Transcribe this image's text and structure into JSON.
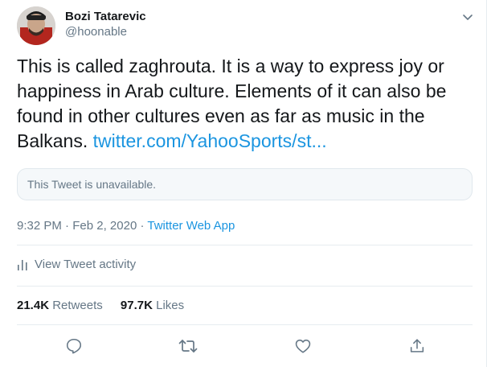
{
  "author": {
    "name": "Bozi Tatarevic",
    "handle": "@hoonable"
  },
  "tweet": {
    "text": "This is called zaghrouta. It is a way to express joy or happiness in Arab culture. Elements of it can also be found in other cultures even as far as music in the Balkans.",
    "link_text": "twitter.com/YahooSports/st..."
  },
  "quoted": {
    "unavailable_text": "This Tweet is unavailable."
  },
  "meta": {
    "time": "9:32 PM",
    "separator1": "·",
    "date": "Feb 2, 2020",
    "separator2": "·",
    "app": "Twitter Web App"
  },
  "activity_label": "View Tweet activity",
  "stats": {
    "retweets_count": "21.4K",
    "retweets_label": "Retweets",
    "likes_count": "97.7K",
    "likes_label": "Likes"
  },
  "icons": {
    "caret": "chevron-down-icon",
    "activity": "bar-chart-icon",
    "reply": "reply-icon",
    "retweet": "retweet-icon",
    "like": "heart-icon",
    "share": "share-icon"
  },
  "colors": {
    "link": "#1b95e0",
    "secondary_text": "#657786",
    "primary_text": "#14171a"
  }
}
